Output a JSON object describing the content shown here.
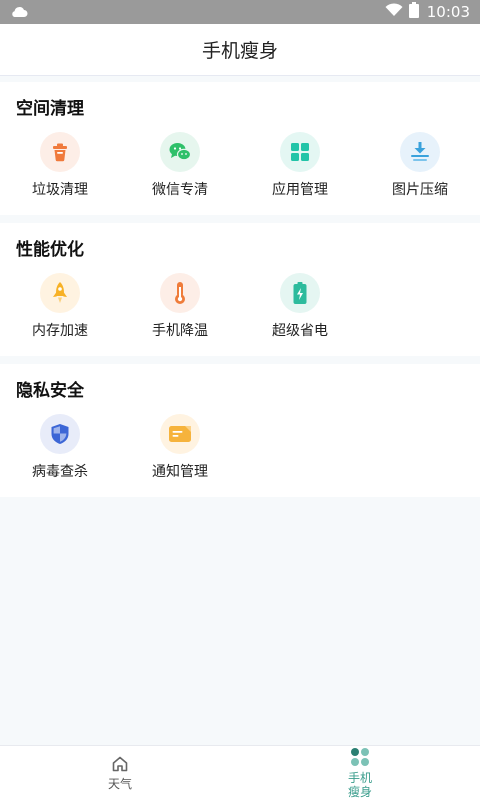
{
  "status_bar": {
    "time": "10:03",
    "icons": [
      "cloud-icon",
      "wifi-icon",
      "battery-icon"
    ]
  },
  "header": {
    "title": "手机瘦身"
  },
  "sections": [
    {
      "title": "空间清理",
      "tools": [
        {
          "label": "垃圾清理",
          "icon": "trash-icon",
          "bg": "#fdeee7",
          "color": "#f07a3c"
        },
        {
          "label": "微信专清",
          "icon": "wechat-icon",
          "bg": "#e6f6ee",
          "color": "#2fc06a"
        },
        {
          "label": "应用管理",
          "icon": "apps-grid-icon",
          "bg": "#e4f7f3",
          "color": "#22c4a8"
        },
        {
          "label": "图片压缩",
          "icon": "download-compress-icon",
          "bg": "#e7f2fb",
          "color": "#3aa2dc"
        }
      ]
    },
    {
      "title": "性能优化",
      "tools": [
        {
          "label": "内存加速",
          "icon": "rocket-icon",
          "bg": "#fff3e1",
          "color": "#f7b126"
        },
        {
          "label": "手机降温",
          "icon": "thermometer-icon",
          "bg": "#fdeee7",
          "color": "#ef7c3a"
        },
        {
          "label": "超级省电",
          "icon": "battery-charge-icon",
          "bg": "#e5f6f2",
          "color": "#2dbb9d"
        }
      ]
    },
    {
      "title": "隐私安全",
      "tools": [
        {
          "label": "病毒查杀",
          "icon": "shield-icon",
          "bg": "#e8ecf9",
          "color": "#3c66d6"
        },
        {
          "label": "通知管理",
          "icon": "message-icon",
          "bg": "#fff3e1",
          "color": "#f6b33c"
        }
      ]
    }
  ],
  "bottom_nav": [
    {
      "label": "天气",
      "icon": "home-icon",
      "active": false
    },
    {
      "label_line1": "手机",
      "label_line2": "瘦身",
      "icon": "dots-grid-icon",
      "active": true,
      "color": "#3a9d8c"
    }
  ]
}
